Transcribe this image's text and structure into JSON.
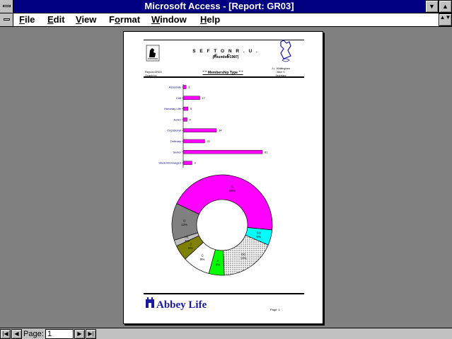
{
  "window": {
    "title": "Microsoft Access - [Report: GR03]",
    "minimize_glyph": "▼",
    "maximize_glyph": "▲",
    "restore_glyph": "▲▼"
  },
  "menu": [
    {
      "label": "File",
      "u": "F",
      "rest": "ile"
    },
    {
      "label": "Edit",
      "u": "E",
      "rest": "dit"
    },
    {
      "label": "View",
      "u": "V",
      "rest": "iew"
    },
    {
      "label": "Format",
      "u": "F",
      "rest": "ormat",
      "prefix": ""
    },
    {
      "label": "Window",
      "u": "W",
      "rest": "indow"
    },
    {
      "label": "Help",
      "u": "H",
      "rest": "elp"
    }
  ],
  "report": {
    "club_name": "S E F T O N   R . U . F . C .",
    "founded": "(Founded 1907)",
    "title": "\" \" Membership Type \" \"",
    "left_small_1": "Report GR03",
    "left_small_2": "Graph by",
    "right_small_1": "J.L. Whittingham",
    "right_small_2": "Mem S",
    "right_small_3": "Secretary",
    "sponsor": "Abbey Life",
    "page_footer": "Page: 1"
  },
  "chart_data": [
    {
      "type": "bar",
      "orientation": "horizontal",
      "categories": [
        "Associate",
        "Colt",
        "Honorary Life",
        "Junior",
        "Occasional",
        "Ordinary",
        "Senior",
        "Student/Unwaged"
      ],
      "values": [
        3,
        17,
        5,
        4,
        34,
        22,
        81,
        9
      ],
      "color": "#ff00ff"
    },
    {
      "type": "pie",
      "donut": true,
      "slices": [
        {
          "label": "S",
          "pct": "45%",
          "value": 45,
          "color": "#ff00ff"
        },
        {
          "label": "SU",
          "pct": "5%",
          "value": 5,
          "color": "#00ffff"
        },
        {
          "label": "OC",
          "pct": "18%",
          "value": 18,
          "color": "#e8e8e8",
          "pattern": "dots"
        },
        {
          "label": "A",
          "pct": "5%",
          "value": 5,
          "color": "#00ff00"
        },
        {
          "label": "C",
          "pct": "9%",
          "value": 9,
          "color": "#ffffff"
        },
        {
          "label": "J",
          "pct": "5%",
          "value": 5,
          "color": "#808000"
        },
        {
          "label": "HL",
          "pct": "2%",
          "value": 2,
          "color": "#c0c0c0"
        },
        {
          "label": "O",
          "pct": "12%",
          "value": 12,
          "color": "#808080"
        }
      ]
    }
  ],
  "status": {
    "page_label": "Page:",
    "page_value": "1"
  }
}
